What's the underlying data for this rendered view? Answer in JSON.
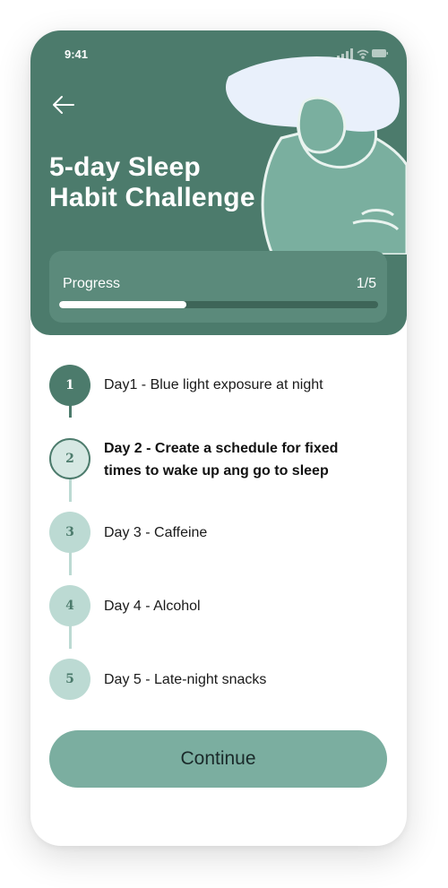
{
  "status_bar": {
    "time": "9:41"
  },
  "header": {
    "title_line1": "5-day Sleep",
    "title_line2": "Habit Challenge"
  },
  "progress": {
    "label": "Progress",
    "count": "1/5",
    "fraction": 0.4
  },
  "steps": [
    {
      "number": "1",
      "label": "Day1 - Blue light exposure at night",
      "state": "completed"
    },
    {
      "number": "2",
      "label_line1": "Day 2 - Create a schedule for fixed",
      "label_line2": "times to wake up ang go to sleep",
      "state": "current"
    },
    {
      "number": "3",
      "label": "Day 3 - Caffeine",
      "state": "upcoming"
    },
    {
      "number": "4",
      "label": "Day 4 - Alcohol",
      "state": "upcoming"
    },
    {
      "number": "5",
      "label": "Day 5 - Late-night snacks",
      "state": "upcoming"
    }
  ],
  "continue_label": "Continue",
  "colors": {
    "header_bg": "#4c7b6c",
    "progress_card": "#5b8a7b",
    "completed": "#4c7b6c",
    "upcoming": "#bcdad3",
    "button": "#7baea0"
  }
}
